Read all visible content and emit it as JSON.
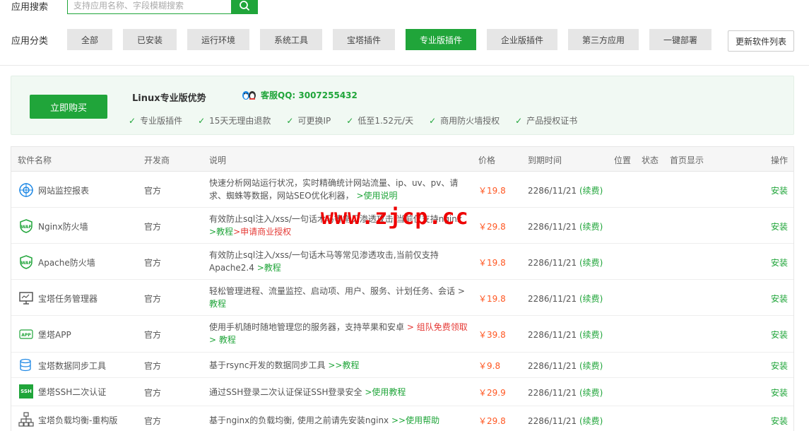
{
  "search": {
    "label": "应用搜索",
    "placeholder": "支持应用名称、字段模糊搜索",
    "value": ""
  },
  "categories": {
    "label": "应用分类",
    "items": [
      {
        "label": "全部",
        "active": false
      },
      {
        "label": "已安装",
        "active": false
      },
      {
        "label": "运行环境",
        "active": false
      },
      {
        "label": "系统工具",
        "active": false
      },
      {
        "label": "宝塔插件",
        "active": false
      },
      {
        "label": "专业版插件",
        "active": true
      },
      {
        "label": "企业版插件",
        "active": false
      },
      {
        "label": "第三方应用",
        "active": false
      },
      {
        "label": "一键部署",
        "active": false
      }
    ],
    "refresh_label": "更新软件列表"
  },
  "banner": {
    "buy_label": "立即购买",
    "title": "Linux专业版优势",
    "qq": "客服QQ: 3007255432",
    "features": [
      "专业版插件",
      "15天无理由退款",
      "可更换IP",
      "低至1.52元/天",
      "商用防火墙授权",
      "产品授权证书"
    ]
  },
  "table": {
    "headers": {
      "name": "软件名称",
      "vendor": "开发商",
      "desc": "说明",
      "price": "价格",
      "expire": "到期时间",
      "position": "位置",
      "status": "状态",
      "home": "首页显示",
      "action": "操作"
    },
    "rows": [
      {
        "name": "网站监控报表",
        "icon": "monitor-target-icon",
        "vendor": "官方",
        "desc1": "快速分析网站运行状况，实时精确统计网站流量、ip、uv、pv、请",
        "desc2": "求、蜘蛛等数据，网站SEO优化利器，",
        "link": ">使用说明",
        "price": "￥19.8",
        "expire": "2286/11/21",
        "renew": "(续费)",
        "action": "安装"
      },
      {
        "name": "Nginx防火墙",
        "icon": "waf-shield-icon",
        "vendor": "官方",
        "desc1": "有效防止sql注入/xss/一句话木马等常见渗透攻击,当前仅支持nginx",
        "desc2": "",
        "link": ">教程",
        "link2": ">申请商业授权",
        "price": "￥29.8",
        "expire": "2286/11/21",
        "renew": "(续费)",
        "action": "安装"
      },
      {
        "name": "Apache防火墙",
        "icon": "waf-shield-icon",
        "vendor": "官方",
        "desc1": "有效防止sql注入/xss/一句话木马等常见渗透攻击,当前仅支持",
        "desc2": "Apache2.4",
        "link": ">教程",
        "price": "￥19.8",
        "expire": "2286/11/21",
        "renew": "(续费)",
        "action": "安装"
      },
      {
        "name": "宝塔任务管理器",
        "icon": "task-manager-icon",
        "vendor": "官方",
        "desc1": "轻松管理进程、流量监控、启动项、用户、服务、计划任务、会话 >",
        "desc2": "",
        "link": "教程",
        "price": "￥19.8",
        "expire": "2286/11/21",
        "renew": "(续费)",
        "action": "安装"
      },
      {
        "name": "堡塔APP",
        "icon": "app-icon",
        "vendor": "官方",
        "desc1": "使用手机随时随地管理您的服务器，支持苹果和安卓",
        "red": "> 组队免费领取",
        "desc2": "",
        "link": "> 教程",
        "price": "￥39.8",
        "expire": "2286/11/21",
        "renew": "(续费)",
        "action": "安装"
      },
      {
        "name": "宝塔数据同步工具",
        "icon": "database-sync-icon",
        "vendor": "官方",
        "desc1": "基于rsync开发的数据同步工具",
        "link": ">>教程",
        "price": "￥9.8",
        "expire": "2286/11/21",
        "renew": "(续费)",
        "action": "安装"
      },
      {
        "name": "堡塔SSH二次认证",
        "icon": "ssh-icon",
        "vendor": "官方",
        "desc1": "通过SSH登录二次认证保证SSH登录安全",
        "link": ">使用教程",
        "price": "￥29.9",
        "expire": "2286/11/21",
        "renew": "(续费)",
        "action": "安装"
      },
      {
        "name": "宝塔负载均衡-重构版",
        "icon": "load-balance-icon",
        "vendor": "官方",
        "desc1": "基于nginx的负载均衡, 使用之前请先安装nginx",
        "link": ">>使用帮助",
        "price": "￥29.8",
        "expire": "2286/11/21",
        "renew": "(续费)",
        "action": "安装"
      }
    ]
  },
  "watermark": "www.zjcp.cc"
}
